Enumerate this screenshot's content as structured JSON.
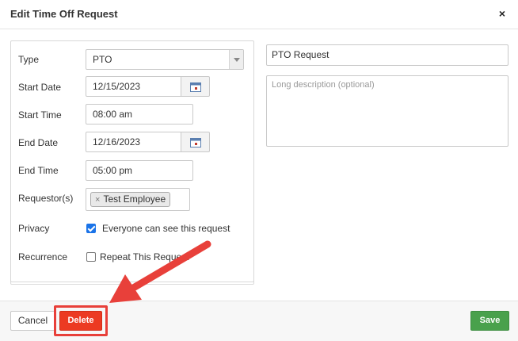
{
  "dialog": {
    "title": "Edit Time Off Request",
    "close_glyph": "×"
  },
  "form": {
    "type": {
      "label": "Type",
      "value": "PTO"
    },
    "start_date": {
      "label": "Start Date",
      "value": "12/15/2023"
    },
    "start_time": {
      "label": "Start Time",
      "value": "08:00 am"
    },
    "end_date": {
      "label": "End Date",
      "value": "12/16/2023"
    },
    "end_time": {
      "label": "End Time",
      "value": "05:00 pm"
    },
    "requestors": {
      "label": "Requestor(s)",
      "tags": [
        "Test Employee"
      ],
      "remove_glyph": "×"
    },
    "privacy": {
      "label": "Privacy",
      "checkbox_label": "Everyone can see this request",
      "checked": true
    },
    "recurrence": {
      "label": "Recurrence",
      "checkbox_label": "Repeat This Request",
      "checked": false
    }
  },
  "details": {
    "title_value": "PTO Request",
    "description_placeholder": "Long description (optional)"
  },
  "footer": {
    "cancel_label": "Cancel",
    "delete_label": "Delete",
    "save_label": "Save"
  },
  "colors": {
    "delete": "#ec3a22",
    "save": "#49a14c",
    "checkbox": "#1a73e8",
    "annotation": "#e8403a"
  },
  "icons": {
    "calendar": "calendar-icon",
    "dropdown": "chevron-down-icon",
    "close": "close-icon"
  }
}
